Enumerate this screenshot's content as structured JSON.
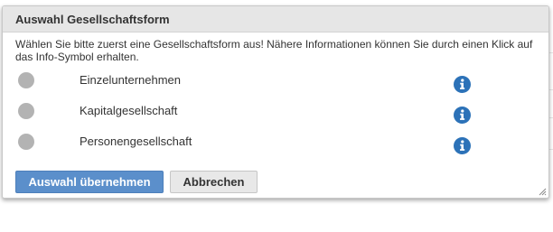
{
  "dialog": {
    "title": "Auswahl Gesellschaftsform",
    "instructions": "Wählen Sie bitte zuerst eine Gesellschaftsform aus! Nähere Informationen können Sie durch einen Klick auf das Info-Symbol erhalten.",
    "options": [
      {
        "label": "Einzelunternehmen",
        "selected": false,
        "icon": "info-icon"
      },
      {
        "label": "Kapitalgesellschaft",
        "selected": false,
        "icon": "info-icon"
      },
      {
        "label": "Personengesellschaft",
        "selected": false,
        "icon": "info-icon"
      }
    ],
    "buttons": {
      "confirm_label": "Auswahl übernehmen",
      "cancel_label": "Abbrechen"
    }
  },
  "colors": {
    "primary_button": "#5b8fcb",
    "info_icon": "#2c72b8",
    "radio_unselected": "#b3b3b3",
    "titlebar": "#e6e6e6"
  }
}
